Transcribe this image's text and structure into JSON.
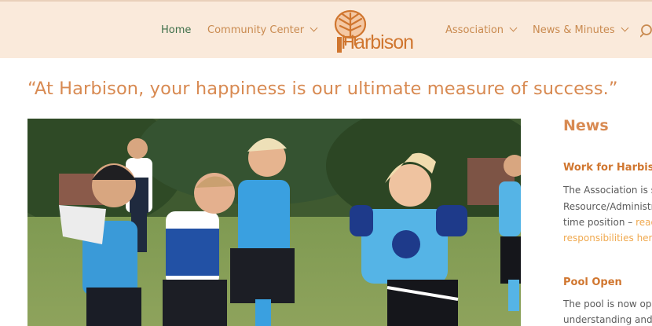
{
  "nav": {
    "home": "Home",
    "community_center": "Community Center",
    "association": "Association",
    "news_minutes": "News & Minutes"
  },
  "logo": {
    "text": "Harbison"
  },
  "hero": {
    "quote": "“At Harbison, your happiness is our ultimate measure of success.”"
  },
  "news": {
    "heading": "News",
    "posts": [
      {
        "title": "Work for Harbis",
        "line1": "The Association is s",
        "line2": "Resource/Administr",
        "line3_text": "time position – ",
        "line3_link": "read",
        "line4_link": "responsibilities here"
      },
      {
        "title": "Pool Open",
        "line1": "The pool is now ope",
        "line2": "understanding and"
      }
    ]
  },
  "colors": {
    "header_bg": "#faeadb",
    "accent": "#d88a52",
    "nav_active": "#3f6f4a",
    "link": "#f0a94f"
  },
  "icons": {
    "search": "search-icon",
    "chevron": "chevron-down-icon",
    "logo": "tree-logo-icon"
  }
}
